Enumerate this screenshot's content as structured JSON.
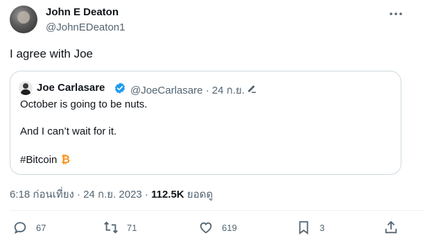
{
  "author": {
    "name": "John E Deaton",
    "handle": "@JohnEDeaton1"
  },
  "tweet": {
    "text": "I agree with Joe"
  },
  "quote": {
    "name": "Joe Carlasare",
    "handle_date": "@JoeCarlasare · 24 ก.ย. ·",
    "lines": [
      "October is going to be nuts.",
      "And I can’t wait for it.",
      "#Bitcoin"
    ]
  },
  "meta": {
    "time_date": "6:18 ก่อนเที่ยง · 24 ก.ย. 2023 · ",
    "views": "112.5K",
    "views_label": " ยอดดู"
  },
  "actions": {
    "replies": "67",
    "reposts": "71",
    "likes": "619",
    "bookmarks": "3"
  },
  "colors": {
    "verified": "#1d9bf0",
    "bitcoin": "#f7931a",
    "muted": "#536471"
  },
  "icons": [
    "more-icon",
    "verified-icon",
    "edit-pencil-icon",
    "bitcoin-icon",
    "reply-icon",
    "repost-icon",
    "like-icon",
    "bookmark-icon",
    "share-icon"
  ]
}
